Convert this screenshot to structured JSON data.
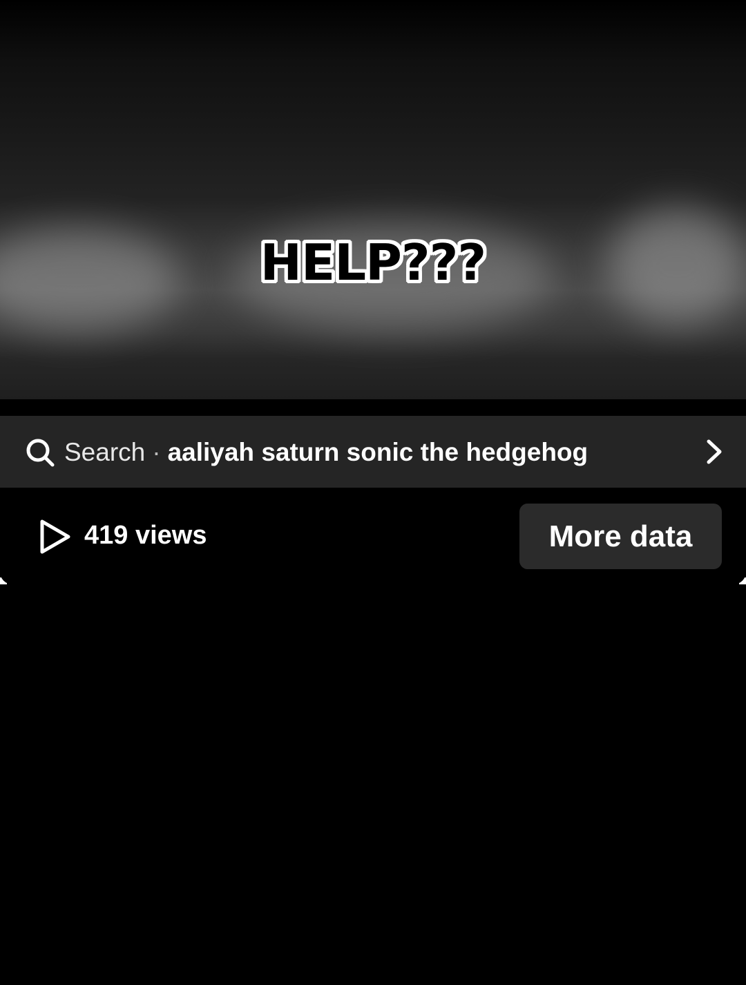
{
  "video": {
    "overlay_text": "HELP???"
  },
  "search": {
    "prefix": "Search",
    "separator": "·",
    "query": "aaliyah saturn sonic the hedgehog",
    "icon": "search-icon",
    "chevron": "chevron-right-icon"
  },
  "stats": {
    "views_label": "419 views",
    "icon": "play-icon",
    "more_button_label": "More data"
  },
  "colors": {
    "background": "#000000",
    "search_bar": "#252525",
    "button": "#2b2b2b",
    "text": "#ffffff"
  }
}
